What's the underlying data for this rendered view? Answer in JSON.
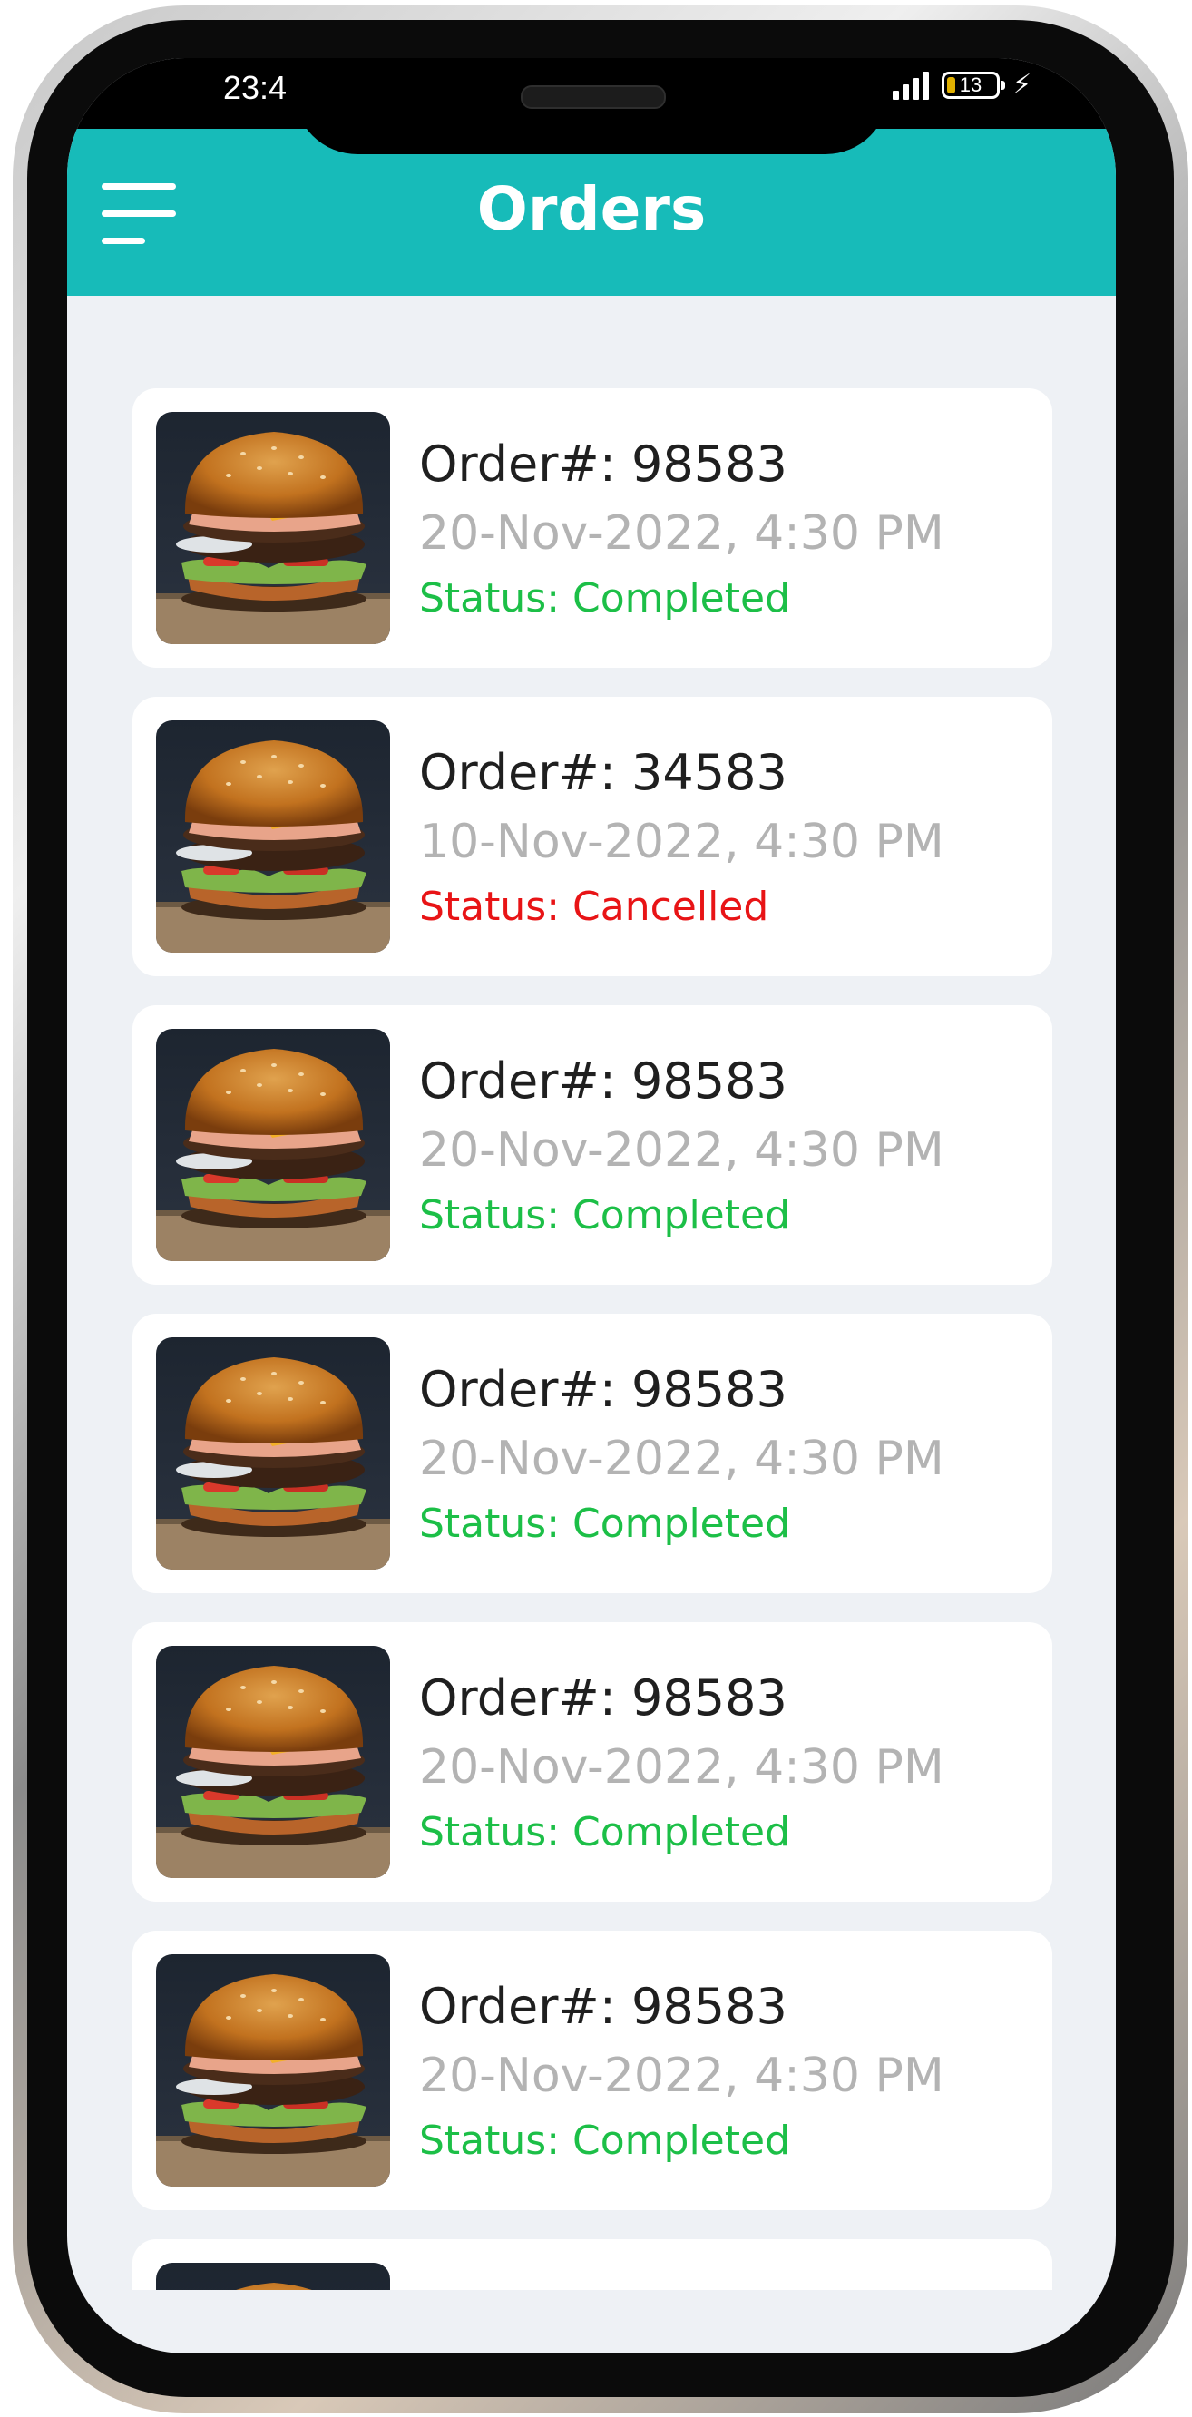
{
  "status_bar": {
    "time": "23:4",
    "battery_level": "13",
    "signal_icon": "signal-bars-icon",
    "charging_icon": "bolt-icon"
  },
  "header": {
    "title": "Orders",
    "menu_icon": "hamburger-menu-icon",
    "background_color": "#17bbb9"
  },
  "colors": {
    "completed": "#1cbf47",
    "cancelled": "#e81416",
    "date": "#b3b3b3"
  },
  "orders": [
    {
      "number": "Order#: 98583",
      "date": "20-Nov-2022, 4:30 PM",
      "status": "Status: Completed",
      "state": "completed",
      "thumbnail_icon": "burger-image"
    },
    {
      "number": "Order#: 34583",
      "date": "10-Nov-2022, 4:30 PM",
      "status": "Status: Cancelled",
      "state": "cancelled",
      "thumbnail_icon": "burger-image"
    },
    {
      "number": "Order#: 98583",
      "date": "20-Nov-2022, 4:30 PM",
      "status": "Status: Completed",
      "state": "completed",
      "thumbnail_icon": "burger-image"
    },
    {
      "number": "Order#: 98583",
      "date": "20-Nov-2022, 4:30 PM",
      "status": "Status: Completed",
      "state": "completed",
      "thumbnail_icon": "burger-image"
    },
    {
      "number": "Order#: 98583",
      "date": "20-Nov-2022, 4:30 PM",
      "status": "Status: Completed",
      "state": "completed",
      "thumbnail_icon": "burger-image"
    },
    {
      "number": "Order#: 98583",
      "date": "20-Nov-2022, 4:30 PM",
      "status": "Status: Completed",
      "state": "completed",
      "thumbnail_icon": "burger-image"
    }
  ]
}
